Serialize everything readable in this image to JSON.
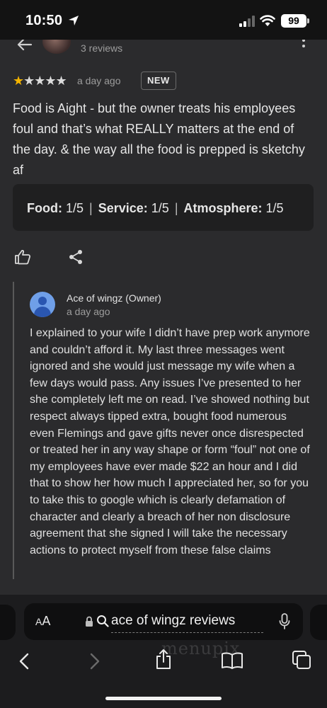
{
  "status_bar": {
    "time": "10:50",
    "battery": "99"
  },
  "header": {
    "reviews_count": "3 reviews"
  },
  "review": {
    "stars_filled": "★",
    "stars_empty": "★★★★",
    "date": "a day ago",
    "badge": "NEW",
    "text": "Food is Aight - but the owner treats his employees foul and that’s what REALLY matters at the end of the day. & the way all the food is prepped is sketchy af",
    "ratings": {
      "food_label": "Food:",
      "food_value": "1/5",
      "service_label": "Service:",
      "service_value": "1/5",
      "atmosphere_label": "Atmosphere:",
      "atmosphere_value": "1/5",
      "separator": "|"
    }
  },
  "owner_reply": {
    "name": "Ace of wingz (Owner)",
    "date": "a day ago",
    "text": "I explained to your wife I didn’t have prep work anymore and couldn’t afford it. My last three messages went ignored and she would just message my wife when a few days would pass. Any issues I’ve presented to her she completely left me on read. I’ve showed nothing but respect always tipped extra, bought food numerous even Flemings and gave gifts never once disrespected or treated her in any way shape or form “foul” not one of my employees have ever made $22 an hour and I did that to show her how much I appreciated her, so for you to take this to google which is clearly defamation of character and clearly a breach of her non disclosure agreement that she signed I will take the necessary actions to protect myself from these false claims"
  },
  "browser": {
    "aa_large": "A",
    "aa_small": "A",
    "url": "ace of wingz reviews",
    "watermark": "menupix"
  },
  "colors": {
    "star": "#f4b400",
    "avatar": "#6f9fe8",
    "background": "#2b2b2d"
  }
}
